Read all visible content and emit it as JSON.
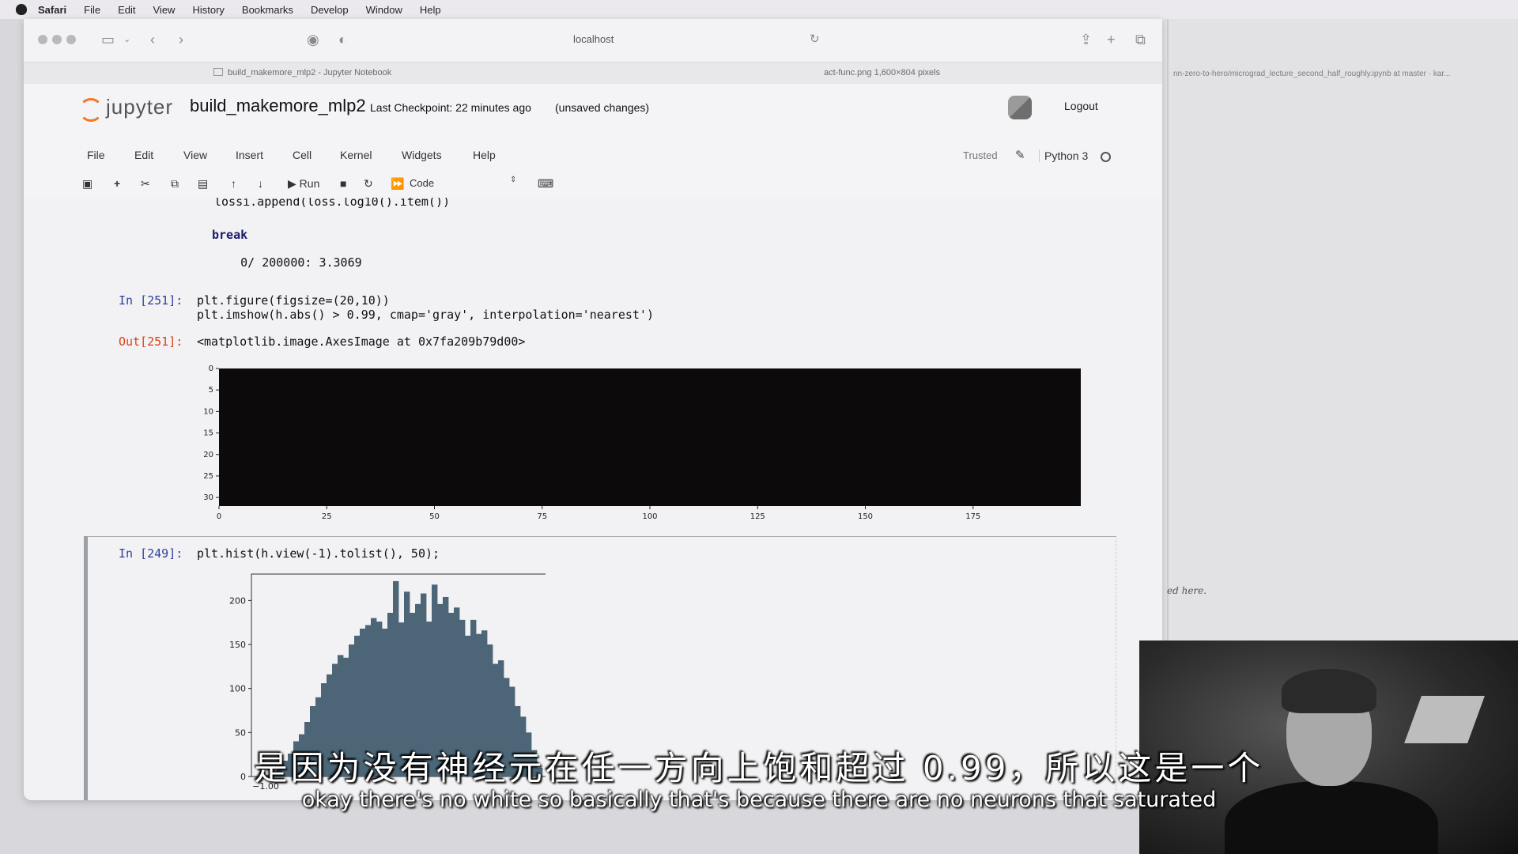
{
  "menubar": {
    "app": "Safari",
    "items": [
      "File",
      "Edit",
      "View",
      "History",
      "Bookmarks",
      "Develop",
      "Window",
      "Help"
    ]
  },
  "browser": {
    "address": "localhost",
    "tab_active": "build_makemore_mlp2 - Jupyter Notebook",
    "tab_other": "act-func.png 1,600×804 pixels"
  },
  "jupyter": {
    "logo_text": "jupyter",
    "notebook_name": "build_makemore_mlp2",
    "checkpoint": "Last Checkpoint: 22 minutes ago",
    "unsaved": "(unsaved changes)",
    "logout": "Logout",
    "menu": [
      "File",
      "Edit",
      "View",
      "Insert",
      "Cell",
      "Kernel",
      "Widgets",
      "Help"
    ],
    "trusted": "Trusted",
    "kernel_name": "Python 3",
    "run_label": "Run",
    "cell_type": "Code"
  },
  "cells": {
    "top_code": "lossi.append(loss.log10().item())",
    "top_out_break": "break",
    "top_out_line": "    0/ 200000: 3.3069",
    "cell251": {
      "prompt_in": "In [251]:",
      "line1": "plt.figure(figsize=(20,10))",
      "line2": "plt.imshow(h.abs() > 0.99, cmap='gray', interpolation='nearest')",
      "prompt_out": "Out[251]:",
      "out_text": "<matplotlib.image.AxesImage at 0x7fa209b79d00>"
    },
    "cell249": {
      "prompt_in": "In [249]:",
      "line1": "plt.hist(h.view(-1).tolist(), 50);"
    }
  },
  "chart_data": [
    {
      "type": "heatmap",
      "title": "",
      "description_values": "all pixels black (no values exceed 0.99)",
      "y_ticks": [
        "0",
        "5",
        "10",
        "15",
        "20",
        "25",
        "30"
      ],
      "x_ticks": [
        "0",
        "25",
        "50",
        "75",
        "100",
        "125",
        "150",
        "175"
      ],
      "xlim": [
        0,
        200
      ],
      "ylim": [
        32,
        0
      ]
    },
    {
      "type": "bar",
      "title": "",
      "y_ticks": [
        "0",
        "50",
        "100",
        "150",
        "200"
      ],
      "x_tick_visible": "−1.00",
      "xlim": [
        -1.0,
        1.0
      ],
      "ylim": [
        0,
        230
      ],
      "values": [
        2,
        6,
        12,
        18,
        26,
        40,
        48,
        62,
        80,
        90,
        106,
        116,
        128,
        138,
        135,
        150,
        160,
        168,
        172,
        180,
        176,
        168,
        186,
        222,
        175,
        210,
        186,
        196,
        208,
        176,
        218,
        196,
        204,
        186,
        192,
        178,
        160,
        178,
        162,
        166,
        150,
        128,
        132,
        112,
        102,
        80,
        68,
        50,
        30,
        10
      ]
    }
  ],
  "side": {
    "path_text": "nn-zero-to-hero/micrograd_lecture_second_half_roughly.ipynb at master · kar...",
    "note_text": "ed here."
  },
  "subtitles": {
    "zh": "是因为没有神经元在任一方向上饱和超过 0.99，所以这是一个",
    "en": "okay there's no white so basically that's because there are no neurons that saturated"
  }
}
